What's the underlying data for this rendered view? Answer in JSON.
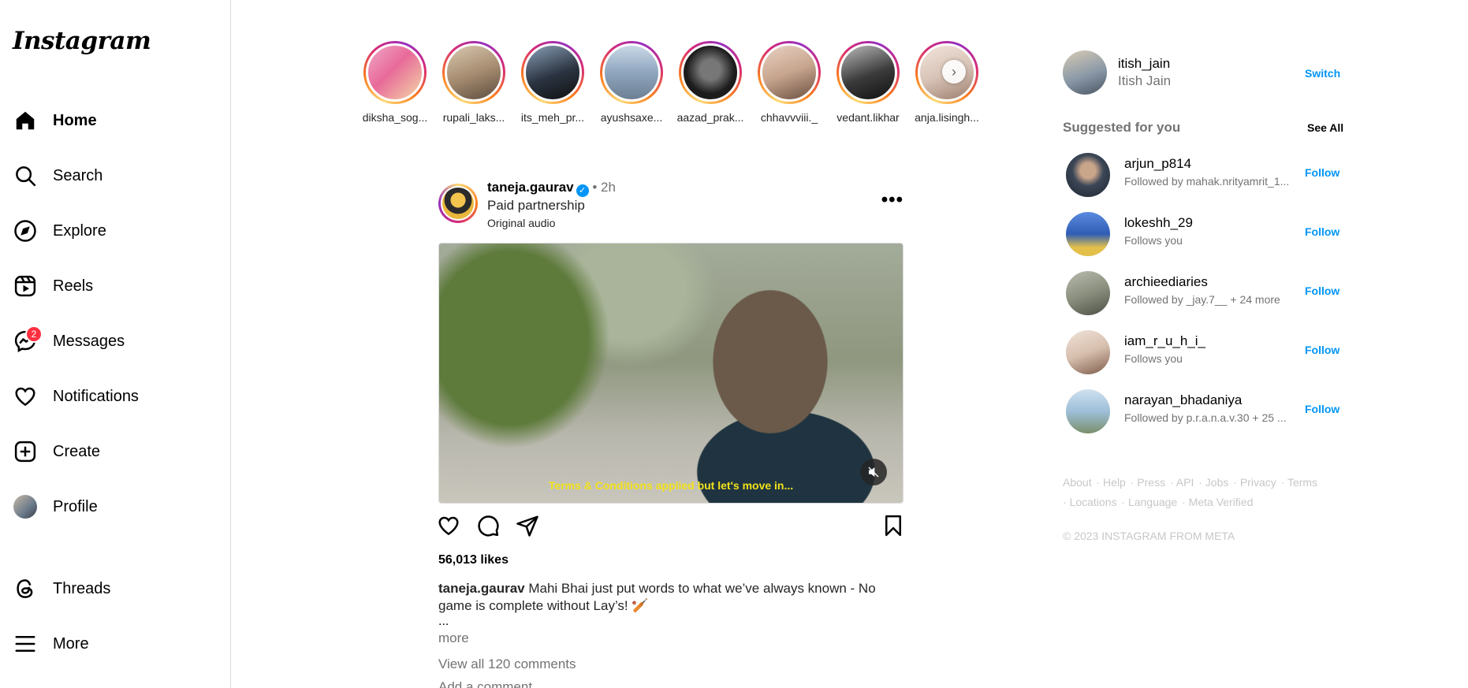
{
  "app": {
    "logo": "Instagram"
  },
  "nav": [
    {
      "label": "Home",
      "icon": "home-icon"
    },
    {
      "label": "Search",
      "icon": "search-icon"
    },
    {
      "label": "Explore",
      "icon": "compass-icon"
    },
    {
      "label": "Reels",
      "icon": "reels-icon"
    },
    {
      "label": "Messages",
      "icon": "messenger-icon",
      "badge": "2"
    },
    {
      "label": "Notifications",
      "icon": "heart-icon"
    },
    {
      "label": "Create",
      "icon": "plus-square-icon"
    },
    {
      "label": "Profile",
      "icon": "avatar"
    },
    {
      "label": "Threads",
      "icon": "threads-icon"
    },
    {
      "label": "More",
      "icon": "hamburger-icon"
    }
  ],
  "stories": [
    {
      "username": "diksha_sog...",
      "color": "#e6b8c8"
    },
    {
      "username": "rupali_laks...",
      "color": "#b8a48c"
    },
    {
      "username": "its_meh_pr...",
      "color": "#2a3340"
    },
    {
      "username": "ayushsaxe...",
      "color": "#8fa6bf"
    },
    {
      "username": "aazad_prak...",
      "color": "#1c1c1c"
    },
    {
      "username": "chhavvviii._",
      "color": "#c7a58e"
    },
    {
      "username": "vedant.likhar",
      "color": "#3a3a3a"
    },
    {
      "username": "anja.lisingh...",
      "color": "#d9c4b8"
    }
  ],
  "post": {
    "username": "taneja.gaurav",
    "time": "2h",
    "subtitle": "Paid partnership",
    "audio": "Original audio",
    "video_caption": "Terms & Conditions applied but let's move in...",
    "likes": "56,013 likes",
    "caption_user": "taneja.gaurav",
    "caption_text": "Mahi Bhai just put words to what we’ve always known - No game is complete without Lay’s! 🏏",
    "ellipsis": "...",
    "more": "more",
    "view_comments": "View all 120 comments",
    "add_comment": "Add a comment..."
  },
  "me": {
    "username": "itish_jain",
    "name": "Itish Jain",
    "switch": "Switch"
  },
  "suggestions": {
    "title": "Suggested for you",
    "see_all": "See All",
    "items": [
      {
        "username": "arjun_p814",
        "sub": "Followed by mahak.nrityamrit_1...",
        "action": "Follow",
        "color": "#3b4656"
      },
      {
        "username": "lokeshh_29",
        "sub": "Follows you",
        "action": "Follow",
        "color": "#2f5db5"
      },
      {
        "username": "archieediaries",
        "sub": "Followed by _jay.7__ + 24 more",
        "action": "Follow",
        "color": "#8a8f7e"
      },
      {
        "username": "iam_r_u_h_i_",
        "sub": "Follows you",
        "action": "Follow",
        "color": "#d7bfae"
      },
      {
        "username": "narayan_bhadaniya",
        "sub": "Followed by p.r.a.n.a.v.30 + 25 ...",
        "action": "Follow",
        "color": "#9dbfd9"
      }
    ]
  },
  "footer": {
    "links": [
      "About",
      "Help",
      "Press",
      "API",
      "Jobs",
      "Privacy",
      "Terms",
      "Locations",
      "Language",
      "Meta Verified"
    ],
    "copyright": "© 2023 INSTAGRAM FROM META"
  }
}
